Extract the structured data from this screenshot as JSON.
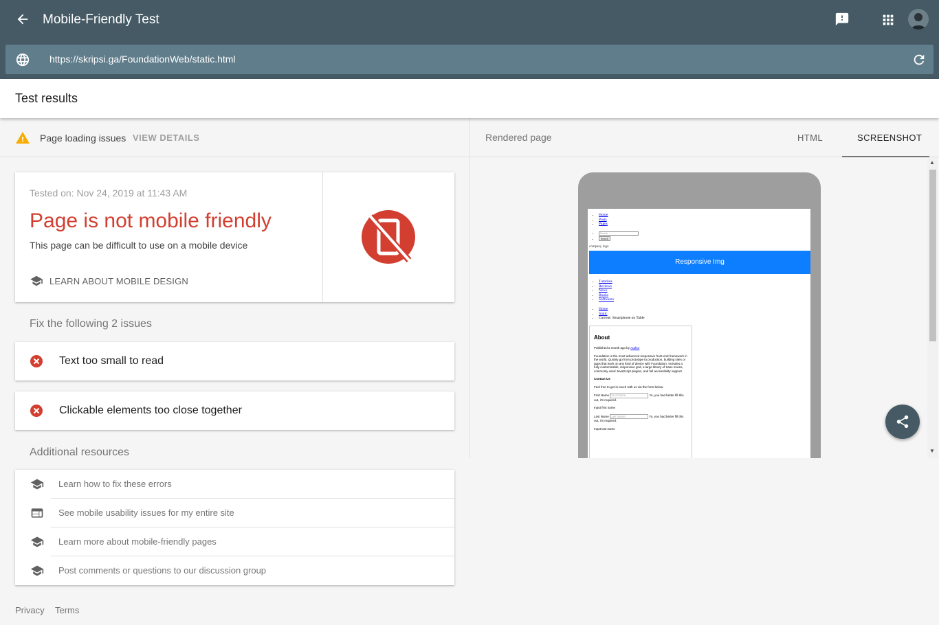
{
  "app": {
    "title": "Mobile-Friendly Test",
    "url": "https://skripsi.ga/FoundationWeb/static.html"
  },
  "results": {
    "header": "Test results",
    "page_loading_issues": "Page loading issues",
    "view_details": "VIEW DETAILS",
    "tested_on": "Tested on: Nov 24, 2019 at 11:43 AM",
    "verdict": "Page is not mobile friendly",
    "verdict_sub": "This page can be difficult to use on a mobile device",
    "learn_link": "LEARN ABOUT MOBILE DESIGN",
    "fix_heading": "Fix the following 2 issues",
    "issues": [
      "Text too small to read",
      "Clickable elements too close together"
    ],
    "resources_heading": "Additional resources",
    "resources": [
      {
        "label": "Learn how to fix these errors",
        "icon": "school-icon"
      },
      {
        "label": "See mobile usability issues for my entire site",
        "icon": "web-icon"
      },
      {
        "label": "Learn more about mobile-friendly pages",
        "icon": "school-icon"
      },
      {
        "label": "Post comments or questions to our discussion group",
        "icon": "school-icon"
      }
    ]
  },
  "footer": {
    "privacy": "Privacy",
    "terms": "Terms"
  },
  "rendered": {
    "label": "Rendered page",
    "tab_html": "HTML",
    "tab_screenshot": "SCREENSHOT",
    "preview": {
      "nav1": [
        "Home",
        "Posts",
        "Pages"
      ],
      "search_placeholder": "Search",
      "search_button": "Search",
      "logo_alt": "company logo",
      "banner": "Responsive Img",
      "nav2": [
        "Tutorials",
        "Reviews",
        "News",
        "Books",
        "Softwares"
      ],
      "crumbs": [
        "Home",
        "Static"
      ],
      "crumb_current": "Current: Smartphone on Table",
      "about_title": "About",
      "published": "Published a month ago by",
      "author": "Author",
      "about_text": "Foundation is the most advanced responsive front-end framework in the world. Quickly go from prototype to production, building sites or apps that work on any kind of device with Foundation. Includes a fully customizable, responsive grid, a large library of Sass mixins, commonly used JavaScript plugins, and full accessibility support.",
      "contact_title": "Contact Us",
      "contact_text": "Feel free to get in touch with us via the form below.",
      "first_name_label": "First Name",
      "first_name_placeholder": "First Name",
      "first_name_hint": "Yo, you had better fill this out, it's required.",
      "first_name_note": "Input first name",
      "last_name_label": "Last Name",
      "last_name_placeholder": "Last Name",
      "last_name_hint": "Yo, you had better fill this out, it's required.",
      "last_name_note": "Input last name"
    }
  },
  "colors": {
    "header": "#455a64",
    "urlbar": "#607d8b",
    "error": "#d23f31",
    "warning": "#f9ab00",
    "banner": "#0d7eff"
  }
}
